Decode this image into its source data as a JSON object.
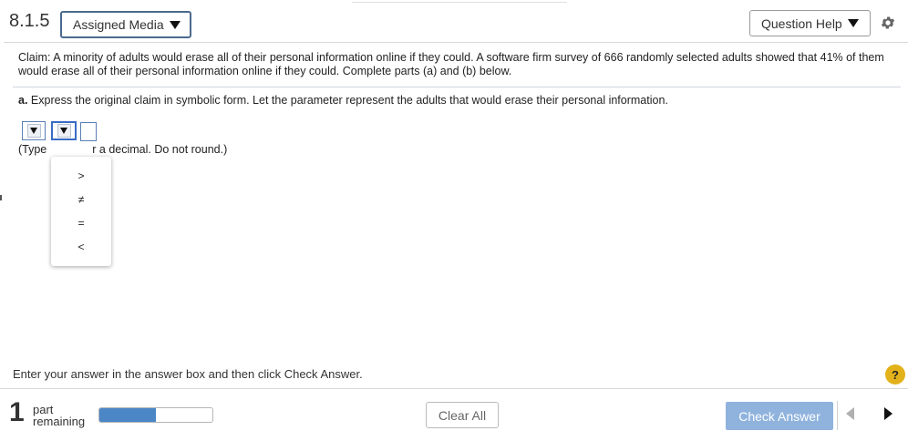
{
  "header": {
    "section_number": "8.1.5",
    "assigned_media_label": "Assigned Media",
    "question_help_label": "Question Help"
  },
  "question": {
    "claim_text": "Claim: A minority of adults would erase all of their personal information online if they could. A software firm survey of 666 randomly selected adults showed that 41% of them would erase all of their personal information online if they could. Complete parts (a) and (b) below.",
    "part_a_label": "a.",
    "part_a_text": "Express the original claim in symbolic form. Let the parameter represent the adults that would erase their personal information.",
    "hint_prefix": "(Type",
    "hint_suffix": "r a decimal. Do not round.)"
  },
  "dropdown_popup": {
    "options": [
      ">",
      "≠",
      "=",
      "<"
    ]
  },
  "footer": {
    "instruction": "Enter your answer in the answer box and then click Check Answer.",
    "help_symbol": "?",
    "parts_count": "1",
    "part_label": "part",
    "remaining_label": "remaining",
    "progress": 0.5,
    "clear_all_label": "Clear All",
    "check_answer_label": "Check Answer"
  },
  "colors": {
    "accent": "#4b86c7",
    "check_button": "#8fb3dd",
    "help_icon": "#e3b21a"
  }
}
